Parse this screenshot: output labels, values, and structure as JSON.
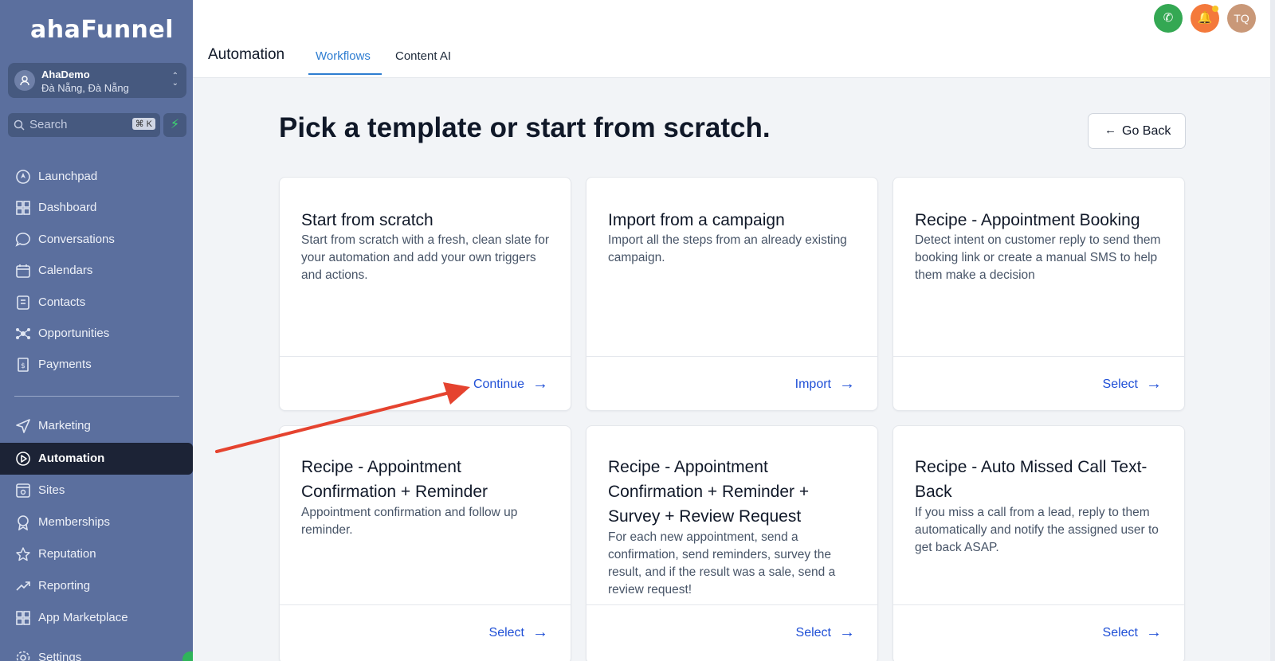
{
  "brand": {
    "logo": "ahaFunnel"
  },
  "account": {
    "name": "AhaDemo",
    "location": "Đà Nẵng, Đà Nẵng"
  },
  "search": {
    "placeholder": "Search",
    "shortcut": "⌘ K"
  },
  "sidebar": {
    "items": [
      {
        "label": "Launchpad",
        "icon": "rocket-icon"
      },
      {
        "label": "Dashboard",
        "icon": "dashboard-icon"
      },
      {
        "label": "Conversations",
        "icon": "chat-icon"
      },
      {
        "label": "Calendars",
        "icon": "calendar-icon"
      },
      {
        "label": "Contacts",
        "icon": "contacts-icon"
      },
      {
        "label": "Opportunities",
        "icon": "opportunities-icon"
      },
      {
        "label": "Payments",
        "icon": "payments-icon"
      },
      {
        "label": "Marketing",
        "icon": "send-icon"
      },
      {
        "label": "Automation",
        "icon": "automation-icon"
      },
      {
        "label": "Sites",
        "icon": "sites-icon"
      },
      {
        "label": "Memberships",
        "icon": "award-icon"
      },
      {
        "label": "Reputation",
        "icon": "star-icon"
      },
      {
        "label": "Reporting",
        "icon": "trend-icon"
      },
      {
        "label": "App Marketplace",
        "icon": "grid-icon"
      },
      {
        "label": "Settings",
        "icon": "gear-icon"
      }
    ],
    "active": "Automation"
  },
  "header": {
    "title": "Automation",
    "tabs": [
      {
        "label": "Workflows",
        "active": true
      },
      {
        "label": "Content AI",
        "active": false
      }
    ],
    "user_initials": "TQ"
  },
  "main": {
    "heading": "Pick a template or start from scratch.",
    "go_back": "Go Back",
    "cards": [
      {
        "title": "Start from scratch",
        "description": "Start from scratch with a fresh, clean slate for your automation and add your own triggers and actions.",
        "action": "Continue"
      },
      {
        "title": "Import from a campaign",
        "description": "Import all the steps from an already existing campaign.",
        "action": "Import"
      },
      {
        "title": "Recipe - Appointment Booking",
        "description": "Detect intent on customer reply to send them booking link or create a manual SMS to help them make a decision",
        "action": "Select"
      },
      {
        "title": "Recipe - Appointment Confirmation + Reminder",
        "description": "Appointment confirmation and follow up reminder.",
        "action": "Select"
      },
      {
        "title": "Recipe - Appointment Confirmation + Reminder + Survey + Review Request",
        "description": "For each new appointment, send a confirmation, send reminders, survey the result, and if the result was a sale, send a review request!",
        "action": "Select"
      },
      {
        "title": "Recipe - Auto Missed Call Text-Back",
        "description": "If you miss a call from a lead, reply to them automatically and notify the assigned user to get back ASAP.",
        "action": "Select"
      }
    ]
  },
  "colors": {
    "sidebar": "#5b6f9e",
    "active_nav": "#1c2336",
    "accent": "#2e7dd1",
    "link": "#1f4fd6",
    "annotation_arrow": "#e5432f"
  }
}
